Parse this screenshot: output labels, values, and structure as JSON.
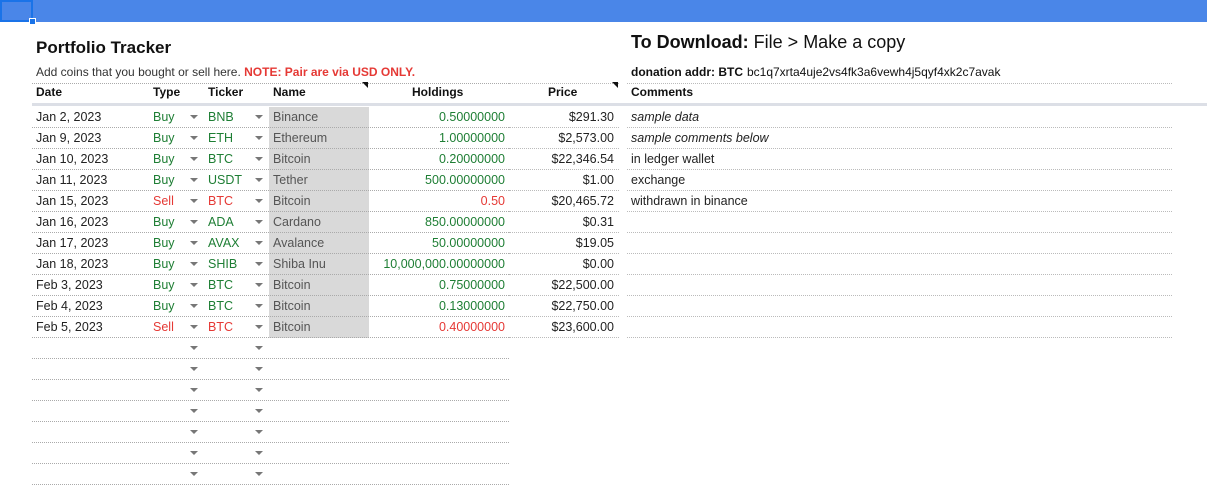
{
  "header": {
    "title": "Portfolio Tracker",
    "subtitle": "Add coins that you bought or sell here.",
    "note": "NOTE: Pair are via USD ONLY.",
    "download_bold": "To Download:",
    "download_rest": "File > Make a copy",
    "donation_label": "donation addr: BTC",
    "donation_addr": "bc1q7xrta4uje2vs4fk3a6vewh4j5qyf4xk2c7avak"
  },
  "columns": {
    "date": "Date",
    "type": "Type",
    "ticker": "Ticker",
    "name": "Name",
    "holdings": "Holdings",
    "price": "Price",
    "comments": "Comments"
  },
  "rows": [
    {
      "date": "Jan 2, 2023",
      "type": "Buy",
      "ticker": "BNB",
      "name": "Binance",
      "holdings": "0.50000000",
      "price": "$291.30",
      "comment": "sample data",
      "italic": true
    },
    {
      "date": "Jan 9, 2023",
      "type": "Buy",
      "ticker": "ETH",
      "name": "Ethereum",
      "holdings": "1.00000000",
      "price": "$2,573.00",
      "comment": "sample comments below",
      "italic": true
    },
    {
      "date": "Jan 10, 2023",
      "type": "Buy",
      "ticker": "BTC",
      "name": "Bitcoin",
      "holdings": "0.20000000",
      "price": "$22,346.54",
      "comment": "in ledger wallet",
      "italic": false
    },
    {
      "date": "Jan 11, 2023",
      "type": "Buy",
      "ticker": "USDT",
      "name": "Tether",
      "holdings": "500.00000000",
      "price": "$1.00",
      "comment": "exchange",
      "italic": false
    },
    {
      "date": "Jan 15, 2023",
      "type": "Sell",
      "ticker": "BTC",
      "name": "Bitcoin",
      "holdings": "0.50",
      "price": "$20,465.72",
      "comment": "withdrawn in binance",
      "italic": false
    },
    {
      "date": "Jan 16, 2023",
      "type": "Buy",
      "ticker": "ADA",
      "name": "Cardano",
      "holdings": "850.00000000",
      "price": "$0.31",
      "comment": "",
      "italic": false
    },
    {
      "date": "Jan 17, 2023",
      "type": "Buy",
      "ticker": "AVAX",
      "name": "Avalance",
      "holdings": "50.00000000",
      "price": "$19.05",
      "comment": "",
      "italic": false
    },
    {
      "date": "Jan 18, 2023",
      "type": "Buy",
      "ticker": "SHIB",
      "name": "Shiba Inu",
      "holdings": "10,000,000.00000000",
      "price": "$0.00",
      "comment": "",
      "italic": false
    },
    {
      "date": "Feb 3, 2023",
      "type": "Buy",
      "ticker": "BTC",
      "name": "Bitcoin",
      "holdings": "0.75000000",
      "price": "$22,500.00",
      "comment": "",
      "italic": false
    },
    {
      "date": "Feb 4, 2023",
      "type": "Buy",
      "ticker": "BTC",
      "name": "Bitcoin",
      "holdings": "0.13000000",
      "price": "$22,750.00",
      "comment": "",
      "italic": false
    },
    {
      "date": "Feb 5, 2023",
      "type": "Sell",
      "ticker": "BTC",
      "name": "Bitcoin",
      "holdings": "0.40000000",
      "price": "$23,600.00",
      "comment": "",
      "italic": false
    }
  ],
  "empty_rows": 7,
  "colors": {
    "buy": "#1e7e34",
    "sell": "#e53935",
    "accent": "#4a86e8"
  },
  "icons": {
    "dropdown": "chevron-down-icon"
  }
}
